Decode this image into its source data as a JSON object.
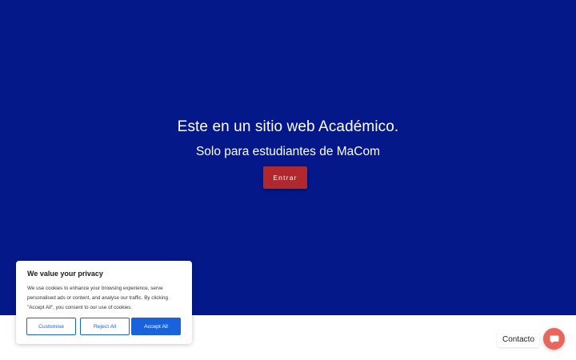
{
  "hero": {
    "title": "Este en un sitio web Académico.",
    "subtitle": "Solo para estudiantes de MaCom",
    "enter_label": "Entrar",
    "background_color": "#041889",
    "button_color": "#b1272c"
  },
  "cookie_banner": {
    "title": "We value your privacy",
    "text": "We use cookies to enhance your browsing experience, serve personalised ads or content, and analyse our traffic. By clicking \"Accept All\", you consent to our use of cookies.",
    "customise_label": "Customise",
    "reject_label": "Reject All",
    "accept_label": "Accept All",
    "accent_color": "#1863dc"
  },
  "contact": {
    "label": "Contacto",
    "button_icon": "chat-bubble-icon",
    "button_color": "#e8665c"
  }
}
